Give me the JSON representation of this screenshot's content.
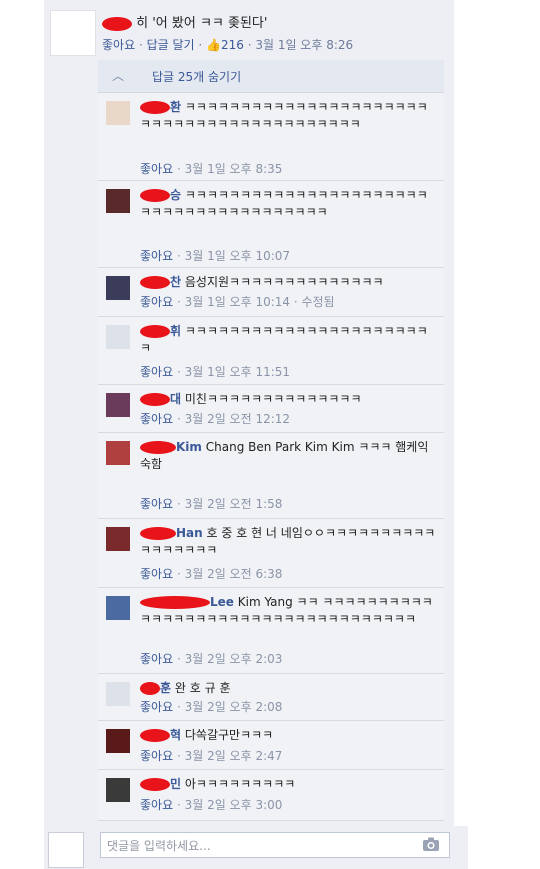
{
  "post": {
    "text": "히 '어 봤어 ㅋㅋ 좆된다'",
    "like": "좋아요",
    "reply": "답글 달기",
    "likes_count": "216",
    "time": "3월 1일 오후 8:26"
  },
  "replies_toggle": {
    "label": "답글 25개 숨기기"
  },
  "comments": [
    {
      "name": "환",
      "text": "ㅋㅋㅋㅋㅋㅋㅋㅋㅋㅋㅋㅋㅋㅋㅋㅋㅋㅋㅋㅋㅋㅋㅋㅋㅋㅋㅋㅋㅋㅋㅋㅋㅋㅋㅋㅋㅋㅋㅋㅋㅋㅋ",
      "like": "좋아요",
      "time": "3월 1일 오후 8:35"
    },
    {
      "name": "승",
      "text": "ㅋㅋㅋㅋㅋㅋㅋㅋㅋㅋㅋㅋㅋㅋㅋㅋㅋㅋㅋㅋㅋㅋㅋㅋㅋㅋㅋㅋㅋㅋㅋㅋㅋㅋㅋㅋㅋㅋㅋ",
      "like": "좋아요",
      "time": "3월 1일 오후 10:07"
    },
    {
      "name": "찬",
      "text": "음성지원ㅋㅋㅋㅋㅋㅋㅋㅋㅋㅋㅋㅋㅋㅋ",
      "like": "좋아요",
      "time": "3월 1일 오후 10:14 · 수정됨"
    },
    {
      "name": "휘",
      "text": "ㅋㅋㅋㅋㅋㅋㅋㅋㅋㅋㅋㅋㅋㅋㅋㅋㅋㅋㅋㅋㅋㅋㅋ",
      "like": "좋아요",
      "time": "3월 1일 오후 11:51"
    },
    {
      "name": "대",
      "text": "미친ㅋㅋㅋㅋㅋㅋㅋㅋㅋㅋㅋㅋㅋㅋ",
      "like": "좋아요",
      "time": "3월 2일 오전 12:12"
    },
    {
      "name": "Kim",
      "text": "Chang  Ben  Park  Kim  Kim ㅋㅋㅋ 햄케익숙함",
      "like": "좋아요",
      "time": "3월 2일 오전 1:58"
    },
    {
      "name": "Han",
      "text": "호 중 호 현 너 네임ㅇㅇㅋㅋㅋㅋㅋㅋㅋㅋㅋㅋㅋㅋㅋㅋㅋㅋㅋ",
      "like": "좋아요",
      "time": "3월 2일 오전 6:38"
    },
    {
      "name": "Lee",
      "text": "Kim  Yang ㅋㅋ ㅋㅋㅋㅋㅋㅋㅋㅋㅋㅋㅋㅋㅋㅋㅋㅋㅋㅋㅋㅋㅋㅋㅋㅋㅋㅋㅋㅋㅋㅋㅋㅋㅋㅋㅋ",
      "like": "좋아요",
      "time": "3월 2일 오후 2:03"
    },
    {
      "name": "훈",
      "text": "완 호 규 훈",
      "like": "좋아요",
      "time": "3월 2일 오후 2:08"
    },
    {
      "name": "혁",
      "text": "다쏙갈구만ㅋㅋㅋ",
      "like": "좋아요",
      "time": "3월 2일 오후 2:47"
    },
    {
      "name": "민",
      "text": "아ㅋㅋㅋㅋㅋㅋㅋㅋㅋ",
      "like": "좋아요",
      "time": "3월 2일 오후 3:00"
    }
  ],
  "comment_input": {
    "placeholder": "댓글을 입력하세요..."
  },
  "icons": {
    "camera": "camera-icon",
    "thumb": "thumbs-up-icon",
    "chevron": "chevron-up-icon"
  }
}
